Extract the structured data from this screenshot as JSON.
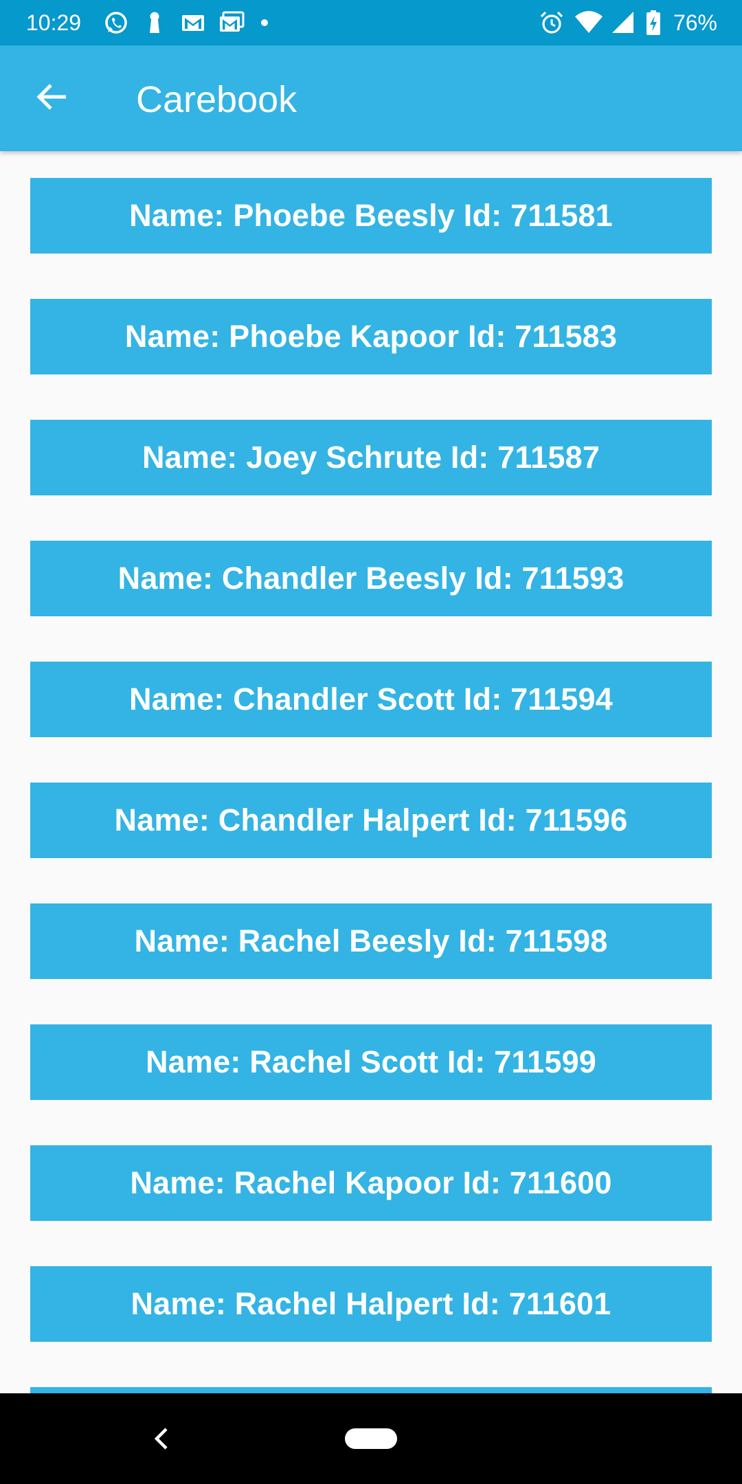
{
  "status_bar": {
    "time": "10:29",
    "battery_percent": "76%",
    "left_icons": [
      "whatsapp-icon",
      "keyhole-icon",
      "gmail-icon",
      "gmail-stack-icon",
      "notification-dot-icon"
    ],
    "right_icons": [
      "alarm-icon",
      "wifi-icon",
      "signal-icon",
      "battery-charging-icon"
    ],
    "background_color": "#0699cc"
  },
  "app_bar": {
    "title": "Carebook",
    "back_icon": "arrow-back-icon",
    "background_color": "#33b4e4"
  },
  "list": {
    "item_color": "#33b4e4",
    "items": [
      {
        "label": "Name: Phoebe Beesly Id: 711581"
      },
      {
        "label": "Name: Phoebe Kapoor Id: 711583"
      },
      {
        "label": "Name: Joey Schrute Id: 711587"
      },
      {
        "label": "Name: Chandler Beesly Id: 711593"
      },
      {
        "label": "Name: Chandler Scott Id: 711594"
      },
      {
        "label": "Name: Chandler Halpert Id: 711596"
      },
      {
        "label": "Name: Rachel Beesly Id: 711598"
      },
      {
        "label": "Name: Rachel Scott Id: 711599"
      },
      {
        "label": "Name: Rachel Kapoor Id: 711600"
      },
      {
        "label": "Name: Rachel Halpert Id: 711601"
      },
      {
        "label": ""
      }
    ]
  },
  "nav_bar": {
    "back_icon": "nav-back-icon",
    "home_icon": "home-pill-icon"
  }
}
